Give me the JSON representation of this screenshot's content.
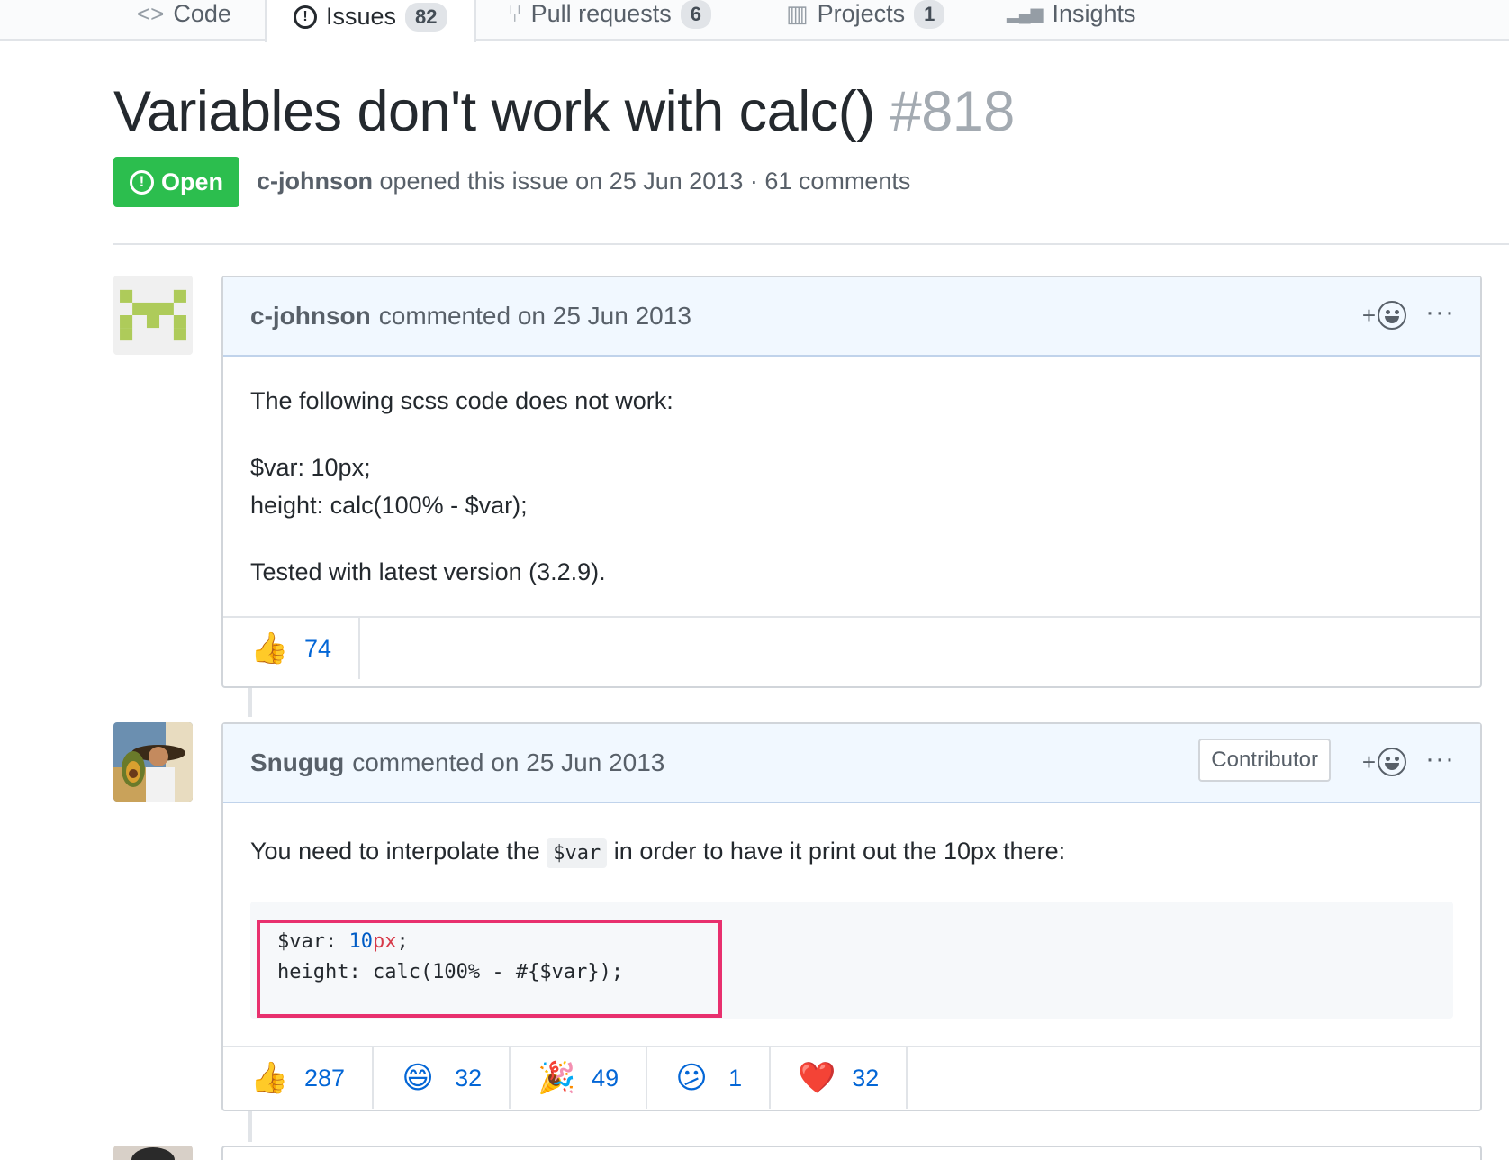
{
  "tabs": [
    {
      "label": "Code",
      "icon": "code-icon",
      "glyph": "<>",
      "count": ""
    },
    {
      "label": "Issues",
      "icon": "issue-icon",
      "glyph": "!",
      "count": "82"
    },
    {
      "label": "Pull requests",
      "icon": "pull-request-icon",
      "glyph": "⑂",
      "count": "6"
    },
    {
      "label": "Projects",
      "icon": "project-icon",
      "glyph": "▥",
      "count": "1"
    },
    {
      "label": "Insights",
      "icon": "graph-icon",
      "glyph": "▂▄▆",
      "count": ""
    }
  ],
  "issue": {
    "title": "Variables don't work with calc()",
    "number": "#818",
    "state": "Open",
    "author": "c-johnson",
    "meta_text": "opened this issue on 25 Jun 2013 · 61 comments"
  },
  "comments": [
    {
      "author": "c-johnson",
      "action": "commented on 25 Jun 2013",
      "body": {
        "line1": "The following scss code does not work:",
        "line2": "$var: 10px;",
        "line3": "height: calc(100% - $var);",
        "line4": "Tested with latest version (3.2.9)."
      },
      "reactions": [
        {
          "icon": "thumbs-up-icon",
          "glyph": "👍",
          "count": "74"
        }
      ]
    },
    {
      "author": "Snugug",
      "action": "commented on 25 Jun 2013",
      "role": "Contributor",
      "body": {
        "before_code": "You need to interpolate the",
        "inline_code": "$var",
        "after_code": "in order to have it print out the 10px there:",
        "code_l1_a": "$var: ",
        "code_l1_num": "10",
        "code_l1_unit": "px",
        "code_l1_end": ";",
        "code_l2": "height: calc(100% - #{$var});"
      },
      "reactions": [
        {
          "icon": "thumbs-up-icon",
          "glyph": "👍",
          "count": "287"
        },
        {
          "icon": "laugh-icon",
          "glyph": "😄",
          "count": "32"
        },
        {
          "icon": "hooray-icon",
          "glyph": "🎉",
          "count": "49"
        },
        {
          "icon": "confused-icon",
          "glyph": "😕",
          "count": "1"
        },
        {
          "icon": "heart-icon",
          "glyph": "❤️",
          "count": "32"
        }
      ]
    }
  ],
  "ui": {
    "add_reaction": "+",
    "more": "···",
    "state_glyph": "!"
  },
  "colors": {
    "open_green": "#2cbe4e",
    "link_blue": "#0366d6",
    "header_bg": "#f1f8ff",
    "highlight_pink": "#e8306e",
    "tab_accent": "#e36209"
  }
}
